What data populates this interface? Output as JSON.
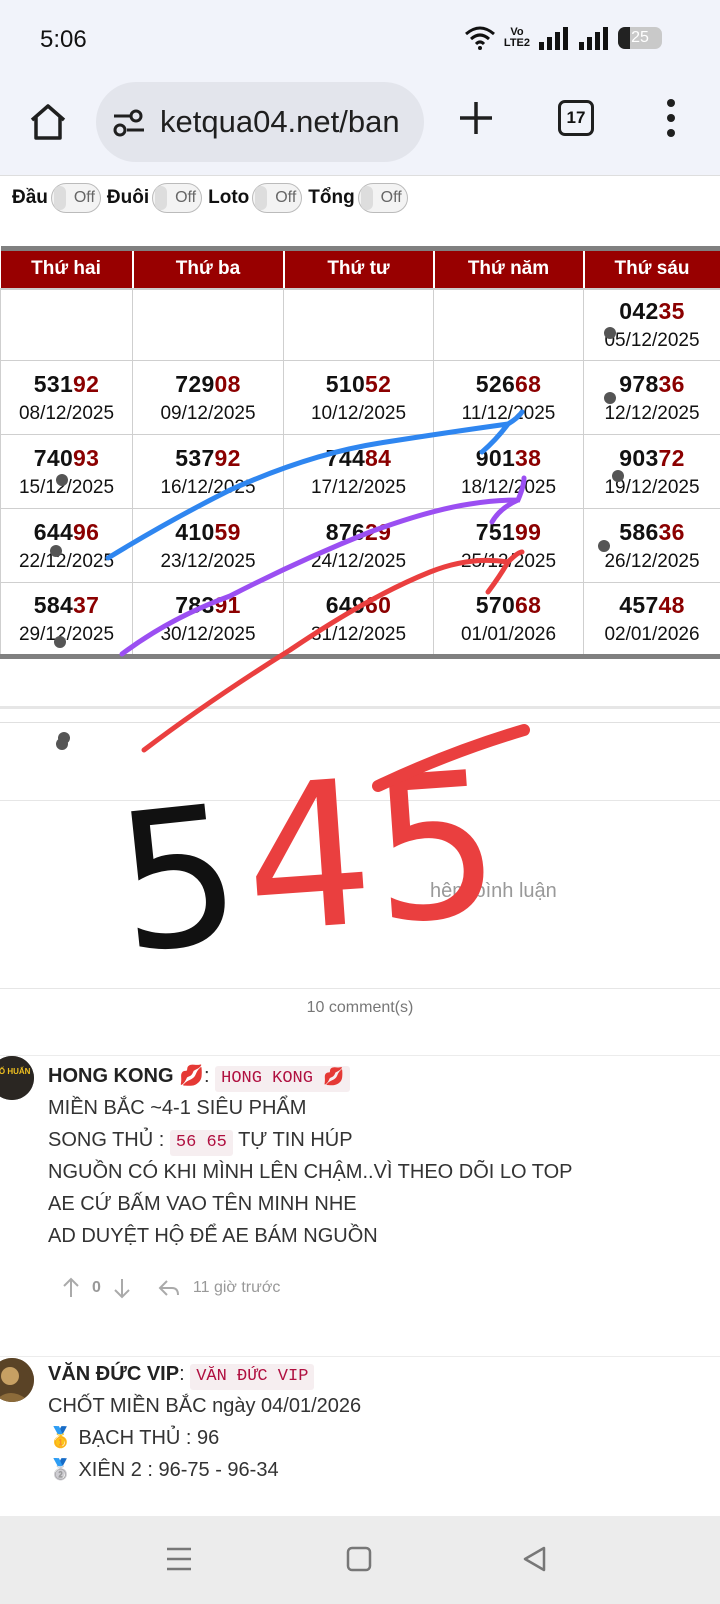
{
  "status_bar": {
    "time": "5:06",
    "volte_top": "Vo",
    "volte_bottom": "LTE2",
    "battery": "25"
  },
  "browser": {
    "url": "ketqua04.net/ban",
    "tab_count": "17"
  },
  "toggles": [
    {
      "label": "Đầu",
      "state": "Off"
    },
    {
      "label": "Đuôi",
      "state": "Off"
    },
    {
      "label": "Loto",
      "state": "Off"
    },
    {
      "label": "Tổng",
      "state": "Off"
    }
  ],
  "table": {
    "headers": [
      "Thứ hai",
      "Thứ ba",
      "Thứ tư",
      "Thứ năm",
      "Thứ sáu"
    ],
    "rows": [
      [
        null,
        null,
        null,
        null,
        {
          "prefix": "042",
          "suffix": "35",
          "date": "05/12/2025"
        }
      ],
      [
        {
          "prefix": "531",
          "suffix": "92",
          "date": "08/12/2025"
        },
        {
          "prefix": "729",
          "suffix": "08",
          "date": "09/12/2025"
        },
        {
          "prefix": "510",
          "suffix": "52",
          "date": "10/12/2025"
        },
        {
          "prefix": "526",
          "suffix": "68",
          "date": "11/12/2025"
        },
        {
          "prefix": "978",
          "suffix": "36",
          "date": "12/12/2025"
        }
      ],
      [
        {
          "prefix": "740",
          "suffix": "93",
          "date": "15/12/2025"
        },
        {
          "prefix": "537",
          "suffix": "92",
          "date": "16/12/2025"
        },
        {
          "prefix": "744",
          "suffix": "84",
          "date": "17/12/2025"
        },
        {
          "prefix": "901",
          "suffix": "38",
          "date": "18/12/2025"
        },
        {
          "prefix": "903",
          "suffix": "72",
          "date": "19/12/2025"
        }
      ],
      [
        {
          "prefix": "644",
          "suffix": "96",
          "date": "22/12/2025"
        },
        {
          "prefix": "410",
          "suffix": "59",
          "date": "23/12/2025"
        },
        {
          "prefix": "876",
          "suffix": "29",
          "date": "24/12/2025"
        },
        {
          "prefix": "751",
          "suffix": "99",
          "date": "25/12/2025"
        },
        {
          "prefix": "586",
          "suffix": "36",
          "date": "26/12/2025"
        }
      ],
      [
        {
          "prefix": "584",
          "suffix": "37",
          "date": "29/12/2025"
        },
        {
          "prefix": "783",
          "suffix": "91",
          "date": "30/12/2025"
        },
        {
          "prefix": "649",
          "suffix": "60",
          "date": "31/12/2025"
        },
        {
          "prefix": "570",
          "suffix": "68",
          "date": "01/01/2026"
        },
        {
          "prefix": "457",
          "suffix": "48",
          "date": "02/01/2026"
        }
      ]
    ]
  },
  "comment_box": {
    "placeholder": "hêm bình luận"
  },
  "comments_count": "10 comment(s)",
  "comments": [
    {
      "author": "HONG KONG 💋",
      "tag": "HONG KONG 💋",
      "avatar_text": "SỐ HUẤN",
      "lines": [
        {
          "text": "MIỀN BẮC ~4-1 SIÊU PHẨM"
        },
        {
          "pre": "SONG THỦ : ",
          "code": "56 65",
          "post": " TỰ TIN HÚP"
        },
        {
          "text": "NGUỒN CÓ KHI MÌNH LÊN CHẬM..VÌ THEO DÕI LO TOP"
        },
        {
          "text": "AE CỨ BẤM VAO TÊN MINH NHE"
        },
        {
          "text": "AD DUYỆT HỘ ĐỂ AE BÁM NGUỒN"
        }
      ],
      "votes": "0",
      "time": "11 giờ trước"
    },
    {
      "author": "VĂN ĐỨC VIP",
      "tag": "VĂN ĐỨC VIP",
      "lines": [
        {
          "text": "CHỐT MIỀN BẮC ngày 04/01/2026"
        },
        {
          "text": "🥇 BẠCH THỦ : 96"
        },
        {
          "text": "🥈 XIÊN 2 : 96-75 - 96-34"
        }
      ]
    }
  ],
  "handwriting": {
    "black_text": "5",
    "red_text": "45"
  },
  "colors": {
    "header_red": "#980000",
    "number_red": "#8b0000",
    "blue_ink": "#2f86f0",
    "purple_ink": "#9b4ff2",
    "red_ink": "#ea3f3f"
  }
}
